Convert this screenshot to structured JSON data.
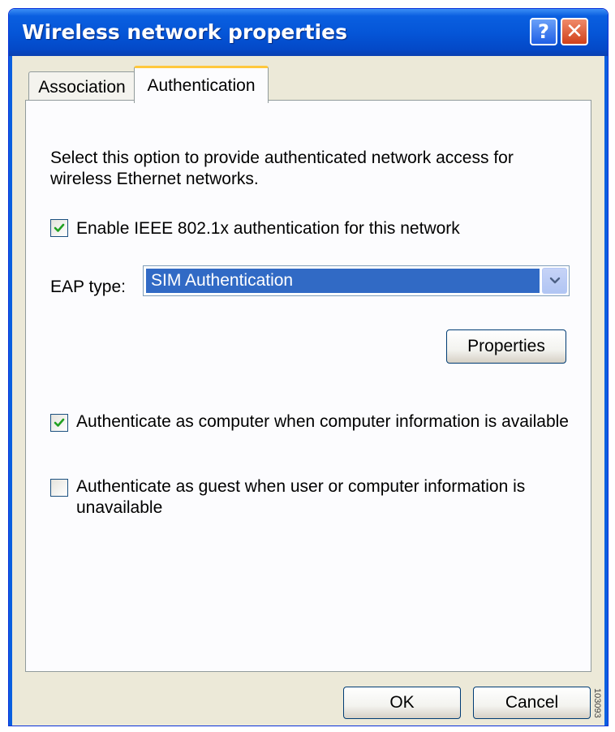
{
  "window": {
    "title": "Wireless network properties"
  },
  "title_buttons": {
    "help": "?",
    "close": "✕"
  },
  "tabs": [
    {
      "label": "Association",
      "active": false
    },
    {
      "label": "Authentication",
      "active": true
    }
  ],
  "authentication": {
    "description_line1": "Select this option to provide authenticated network access for",
    "description_line2": "wireless Ethernet networks.",
    "enable_8021x": {
      "label": "Enable IEEE 802.1x authentication for this network",
      "checked": true
    },
    "eap_type": {
      "label": "EAP type:",
      "value": "SIM Authentication"
    },
    "properties_button": "Properties",
    "auth_as_computer": {
      "label": "Authenticate as computer when computer information is available",
      "checked": true
    },
    "auth_as_guest": {
      "label_line1": "Authenticate as guest when user or computer information is",
      "label_line2": "unavailable",
      "checked": false
    }
  },
  "footer": {
    "ok_label": "OK",
    "cancel_label": "Cancel"
  },
  "side_mark": "103093",
  "colors": {
    "title_bar": "#0556d8",
    "selection": "#316ac5",
    "checkmark": "#21a121",
    "active_tab_highlight": "#ffc83c"
  }
}
